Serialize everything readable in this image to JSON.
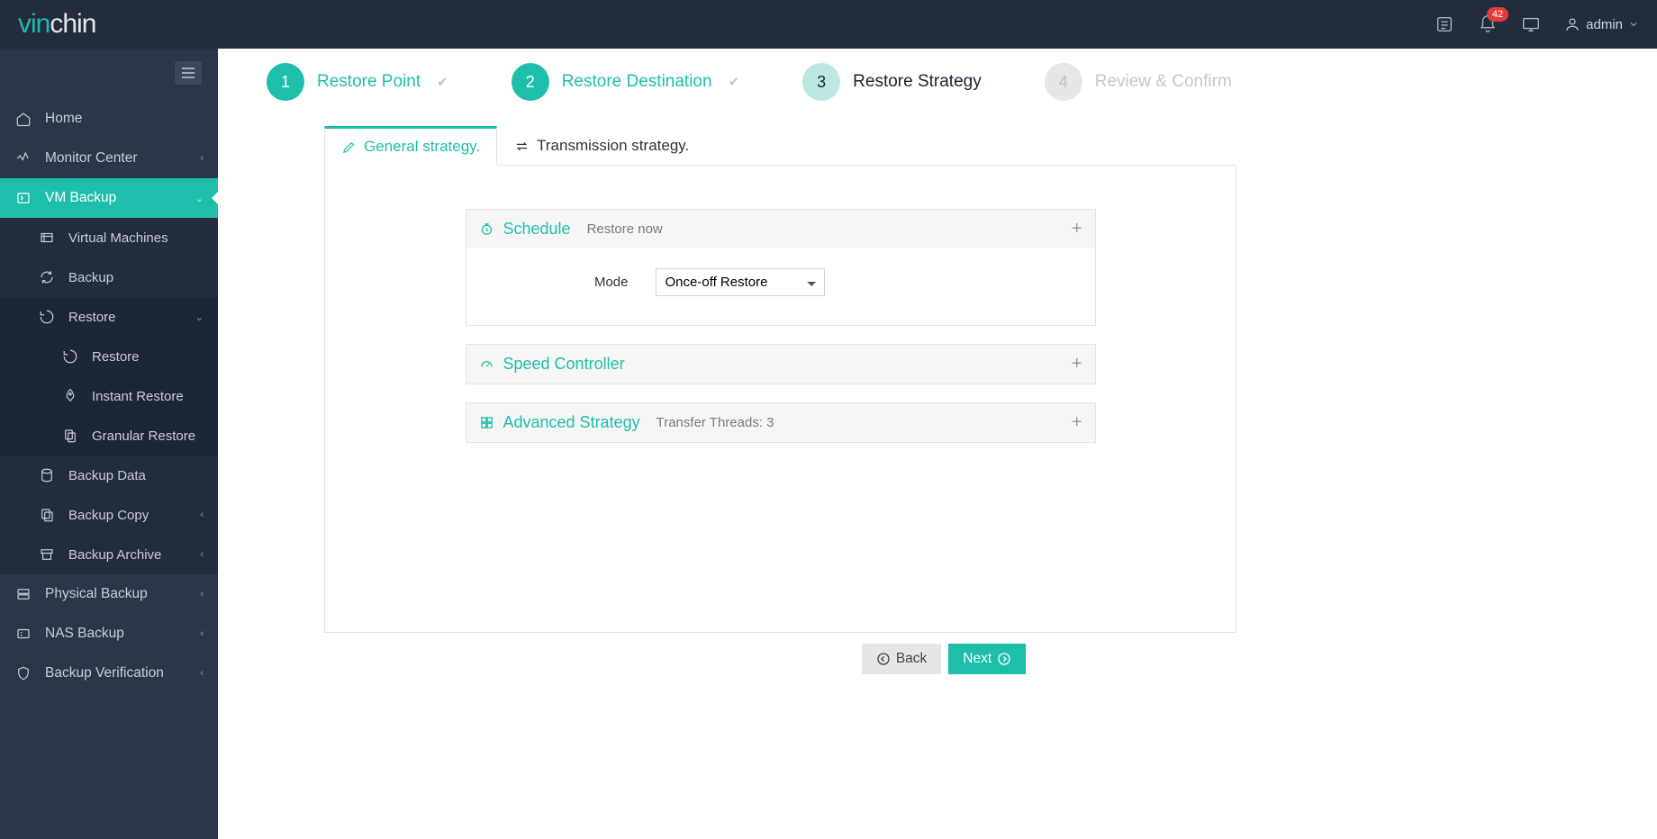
{
  "brand": {
    "prefix": "vin",
    "suffix": "chin"
  },
  "topbar": {
    "badge": "42",
    "user": "admin"
  },
  "sidebar": {
    "home": "Home",
    "monitor": "Monitor Center",
    "vmbackup": "VM Backup",
    "sub": {
      "vms": "Virtual Machines",
      "backup": "Backup",
      "restore": "Restore",
      "restore2": "Restore",
      "instant": "Instant Restore",
      "granular": "Granular Restore",
      "backupdata": "Backup Data",
      "backupcopy": "Backup Copy",
      "backuparchive": "Backup Archive"
    },
    "physical": "Physical Backup",
    "nas": "NAS Backup",
    "verification": "Backup Verification"
  },
  "steps": {
    "s1": "Restore Point",
    "s2": "Restore Destination",
    "s3": "Restore Strategy",
    "s4": "Review & Confirm"
  },
  "tabs": {
    "general": "General strategy.",
    "transmission": "Transmission strategy."
  },
  "sections": {
    "schedule": {
      "title": "Schedule",
      "sub": "Restore now",
      "mode_label": "Mode",
      "mode_value": "Once-off Restore"
    },
    "speed": {
      "title": "Speed Controller"
    },
    "advanced": {
      "title": "Advanced Strategy",
      "sub": "Transfer Threads: 3"
    }
  },
  "buttons": {
    "back": "Back",
    "next": "Next"
  }
}
